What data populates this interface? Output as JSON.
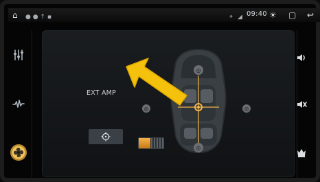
{
  "status_bar": {
    "time": "09:40",
    "icons": [
      "home-icon",
      "status-indicators",
      "location-icon",
      "signal-icon",
      "brightness-icon",
      "window-icon",
      "back-icon"
    ]
  },
  "left_rail": {
    "items": [
      {
        "name": "equalizer-sliders-icon"
      },
      {
        "name": "audio-waveform-icon"
      },
      {
        "name": "balance-fan-icon",
        "active": true
      }
    ]
  },
  "right_rail": {
    "items": [
      {
        "name": "volume-icon"
      },
      {
        "name": "mute-icon"
      },
      {
        "name": "crown-icon"
      }
    ]
  },
  "main": {
    "ext_amp_label": "EXT AMP",
    "ext_amp_on": true
  },
  "colors": {
    "accent": "#f2b34a",
    "arrow": "#f4c20d",
    "dot": "#6b6f73"
  }
}
